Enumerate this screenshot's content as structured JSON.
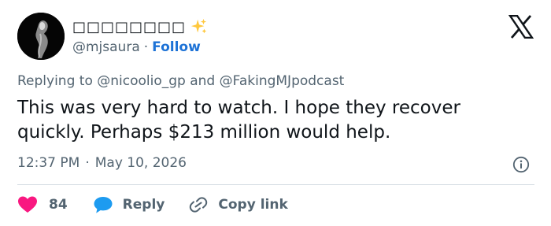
{
  "tweet": {
    "display_name": "□□□□□□□□",
    "handle": "@mjsaura",
    "separator": "·",
    "follow_label": "Follow",
    "replying_prefix": "Replying to",
    "reply_mentions": [
      "@nicoolio_gp",
      "@FakingMJpodcast"
    ],
    "reply_connector": "and",
    "text": "This was very hard to watch. I hope they recover quickly. Perhaps $213 million would help.",
    "time": "12:37 PM",
    "date": "May 10, 2026",
    "time_separator": "·"
  },
  "actions": {
    "like_count": "84",
    "reply_label": "Reply",
    "copy_label": "Copy link"
  },
  "icons": {
    "sparkle": "sparkles-icon",
    "x_logo": "x-logo-icon",
    "info": "info-icon",
    "heart": "heart-icon",
    "reply": "speech-bubble-icon",
    "link": "link-icon"
  },
  "colors": {
    "accent": "#1d72d6",
    "heart": "#f91880",
    "reply_bubble": "#1d9bf0",
    "muted": "#536471",
    "sparkle": "#ffc83d"
  }
}
